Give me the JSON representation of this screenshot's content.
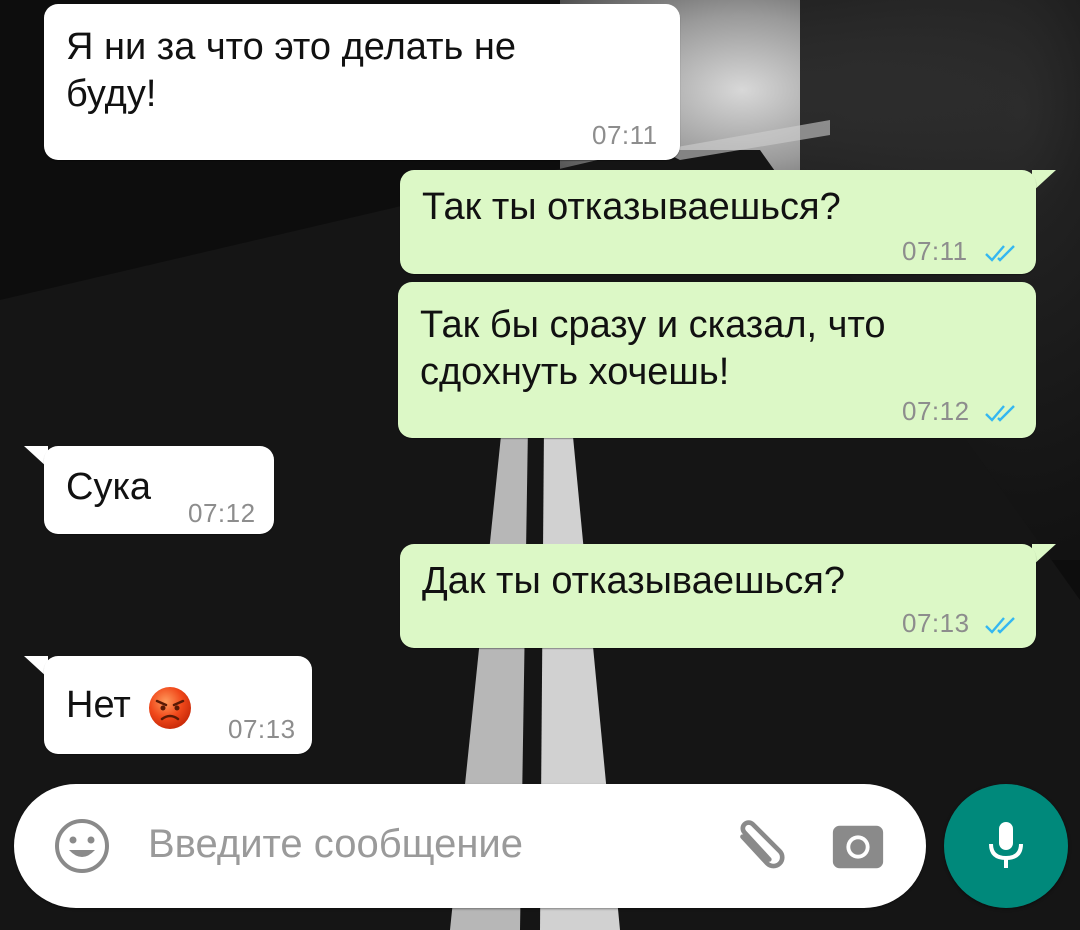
{
  "messages": [
    {
      "direction": "in",
      "text": "Я ни за что это делать не\nбуду!",
      "time": "07:11"
    },
    {
      "direction": "out",
      "text": "Так ты отказываешься?",
      "time": "07:11",
      "status": "read"
    },
    {
      "direction": "out",
      "text": "Так бы сразу и сказал, что\nсдохнуть хочешь!",
      "time": "07:12",
      "status": "read"
    },
    {
      "direction": "in",
      "text": "Сука",
      "time": "07:12"
    },
    {
      "direction": "out",
      "text": "Дак ты отказываешься?",
      "time": "07:13",
      "status": "read"
    },
    {
      "direction": "in",
      "text": "Нет",
      "emoji": "angry-face",
      "time": "07:13"
    }
  ],
  "composer": {
    "placeholder": "Введите сообщение",
    "icons": [
      "emoji-smiley-icon",
      "attach-paperclip-icon",
      "camera-icon"
    ]
  },
  "mic_button": {
    "icon": "microphone-icon"
  },
  "colors": {
    "incoming_bubble": "#ffffff",
    "outgoing_bubble": "#dcf8c6",
    "timestamp": "#8d8d8d",
    "read_ticks": "#34b7f1",
    "mic_button": "#00897b",
    "composer_icons": "#8a8a8a"
  }
}
